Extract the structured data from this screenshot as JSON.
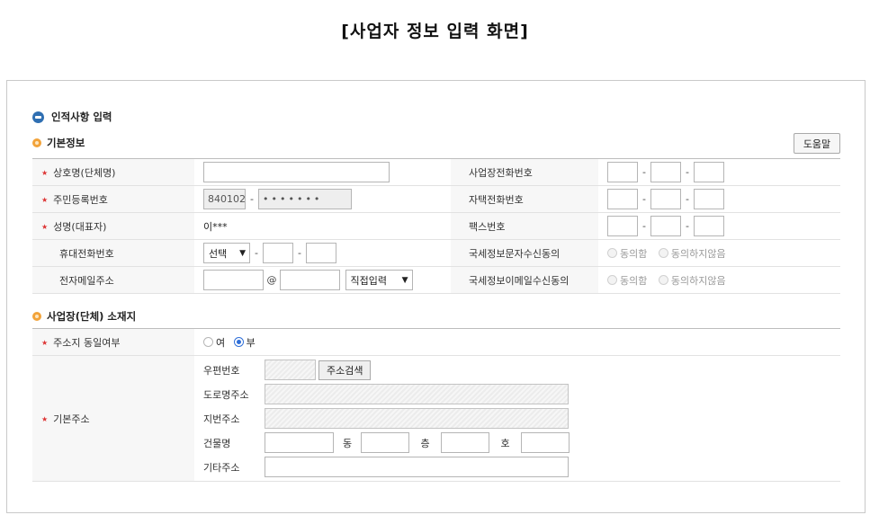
{
  "page_title": "[사업자 정보 입력 화면]",
  "section_main": "인적사항 입력",
  "sub_basic": "기본정보",
  "help_label": "도움말",
  "basic": {
    "company_name_label": "상호명(단체명)",
    "company_name_value": "",
    "biz_phone_label": "사업장전화번호",
    "resident_no_label": "주민등록번호",
    "resident_no_front": "840102",
    "resident_no_back": "•••••••",
    "home_phone_label": "자택전화번호",
    "representative_label": "성명(대표자)",
    "representative_value": "이***",
    "fax_label": "팩스번호",
    "mobile_label": "휴대전화번호",
    "mobile_select": "선택",
    "sms_consent_label": "국세정보문자수신동의",
    "email_label": "전자메일주소",
    "email_at": "@",
    "email_domain_select": "직접입력",
    "email_consent_label": "국세정보이메일수신동의",
    "agree": "동의함",
    "disagree": "동의하지않음",
    "dash": "-"
  },
  "sub_location": "사업장(단체) 소재지",
  "location": {
    "same_address_label": "주소지 동일여부",
    "yes": "여",
    "no": "부",
    "selected": "no",
    "base_address_label": "기본주소",
    "postal_label": "우편번호",
    "address_search_button": "주소검색",
    "road_address_label": "도로명주소",
    "lot_address_label": "지번주소",
    "building_label": "건물명",
    "dong_label": "동",
    "floor_label": "층",
    "ho_label": "호",
    "other_address_label": "기타주소"
  }
}
